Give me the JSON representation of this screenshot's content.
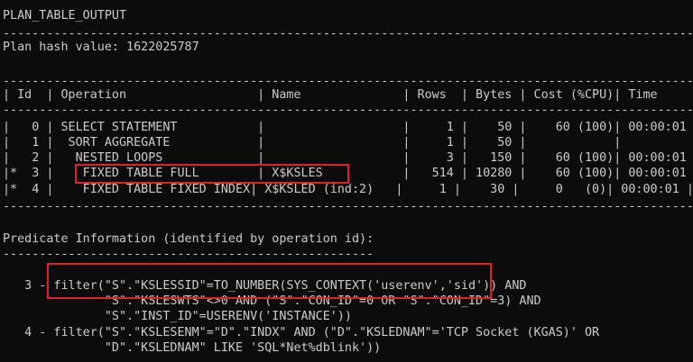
{
  "terminal": {
    "lines": [
      "PLAN_TABLE_OUTPUT",
      "--------------------------------------------------------------------------------------------------------",
      "Plan hash value: 1622025787",
      "",
      "--------------------------------------------------------------------------------------------------------",
      "| Id  | Operation                  | Name              | Rows  | Bytes | Cost (%CPU)| Time     |",
      "--------------------------------------------------------------------------------------------------------",
      "|   0 | SELECT STATEMENT           |                   |     1 |    50 |    60 (100)| 00:00:01 |",
      "|   1 |  SORT AGGREGATE            |                   |     1 |    50 |            |          |",
      "|   2 |   NESTED LOOPS             |                   |     3 |   150 |    60 (100)| 00:00:01 |",
      "|*  3 |    FIXED TABLE FULL        | X$KSLES           |   514 | 10280 |    60 (100)| 00:00:01 |",
      "|*  4 |    FIXED TABLE FIXED INDEX| X$KSLED (ind:2)   |     1 |    30 |     0   (0)| 00:00:01 |",
      "--------------------------------------------------------------------------------------------------------",
      "",
      "Predicate Information (identified by operation id):",
      "---------------------------------------------------",
      "",
      "   3 - filter(\"S\".\"KSLESSID\"=TO_NUMBER(SYS_CONTEXT('userenv','sid')) AND",
      "              \"S\".\"KSLESWTS\"<>0 AND (\"S\".\"CON_ID\"=0 OR \"S\".\"CON_ID\"=3) AND",
      "              \"S\".\"INST_ID\"=USERENV('INSTANCE'))",
      "   4 - filter(\"S\".\"KSLESENM\"=\"D\".\"INDX\" AND (\"D\".\"KSLEDNAM\"='TCP Socket (KGAS)' OR",
      "              \"D\".\"KSLEDNAM\" LIKE 'SQL*Net%dblink'))"
    ]
  },
  "colors": {
    "background": "#0c0c0c",
    "text": "#cccccc",
    "highlight_border": "#e0202a"
  }
}
